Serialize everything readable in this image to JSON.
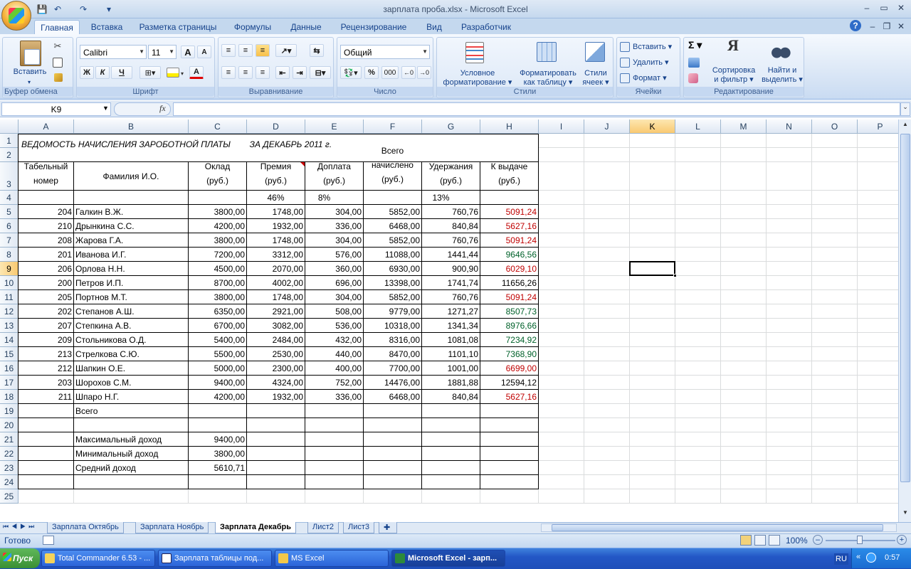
{
  "window": {
    "title": "зарплата проба.xlsx - Microsoft Excel",
    "min": "–",
    "max": "▭",
    "close": "✕",
    "ribbon_help": "?",
    "ribbon_min": "–",
    "ribbon_restore": "❐",
    "ribbon_close": "✕"
  },
  "qat": {
    "save": "💾",
    "undo": "↶",
    "redo": "↷",
    "customize": "▾"
  },
  "tabs": [
    "Главная",
    "Вставка",
    "Разметка страницы",
    "Формулы",
    "Данные",
    "Рецензирование",
    "Вид",
    "Разработчик"
  ],
  "ribbon": {
    "clipboard": {
      "label": "Буфер обмена",
      "paste": "Вставить"
    },
    "font": {
      "label": "Шрифт",
      "name": "Calibri",
      "size": "11",
      "grow": "A",
      "shrink": "A",
      "bold": "Ж",
      "italic": "К",
      "underline": "Ч",
      "color_letter": "А"
    },
    "align": {
      "label": "Выравнивание"
    },
    "number": {
      "label": "Число",
      "format": "Общий",
      "percent": "%",
      "thousands": "000"
    },
    "styles": {
      "label": "Стили",
      "cond": [
        "Условное",
        "форматирование ▾"
      ],
      "table": [
        "Форматировать",
        "как таблицу ▾"
      ],
      "cell": [
        "Стили",
        "ячеек ▾"
      ]
    },
    "cells": {
      "label": "Ячейки",
      "insert": "Вставить ▾",
      "delete": "Удалить ▾",
      "format": "Формат ▾"
    },
    "editing": {
      "label": "Редактирование",
      "sum": "Σ ▾",
      "sort": [
        "Сортировка",
        "и фильтр ▾"
      ],
      "find": [
        "Найти и",
        "выделить ▾"
      ]
    }
  },
  "formula_bar": {
    "name_box": "K9",
    "fx": "fx",
    "value": ""
  },
  "columns": [
    "A",
    "B",
    "C",
    "D",
    "E",
    "F",
    "G",
    "H",
    "I",
    "J",
    "K",
    "L",
    "M",
    "N",
    "O",
    "P"
  ],
  "rows": [
    "1",
    "2",
    "3",
    "4",
    "5",
    "6",
    "7",
    "8",
    "9",
    "10",
    "11",
    "12",
    "13",
    "14",
    "15",
    "16",
    "17",
    "18",
    "19",
    "20",
    "21",
    "22",
    "23",
    "24",
    "25"
  ],
  "sheet": {
    "title": "ВЕДОМОСТЬ НАЧИСЛЕНИЯ ЗАРОБОТНОЙ ПЛАТЫ        ЗА ДЕКАБРЬ 2011 г.",
    "headers": [
      [
        "Табельный",
        "номер"
      ],
      [
        "Фамилия И.О."
      ],
      [
        "Оклад",
        "(руб.)"
      ],
      [
        "Премия",
        "(руб.)"
      ],
      [
        "Доплата",
        "(руб.)"
      ],
      [
        "Всего",
        "начислено",
        "(руб.)"
      ],
      [
        "Удержания",
        "(руб.)"
      ],
      [
        "К выдаче",
        "(руб.)"
      ]
    ],
    "rates": {
      "bonus": "46%",
      "extra": "8%",
      "deduct": "13%"
    },
    "data": [
      {
        "id": "204",
        "name": "Галкин В.Ж.",
        "salary": "3800,00",
        "bonus": "1748,00",
        "extra": "304,00",
        "total": "5852,00",
        "deduct": "760,76",
        "pay": "5091,24",
        "pay_color": "red"
      },
      {
        "id": "210",
        "name": "Дрынкина С.С.",
        "salary": "4200,00",
        "bonus": "1932,00",
        "extra": "336,00",
        "total": "6468,00",
        "deduct": "840,84",
        "pay": "5627,16",
        "pay_color": "red"
      },
      {
        "id": "208",
        "name": "Жарова Г.А.",
        "salary": "3800,00",
        "bonus": "1748,00",
        "extra": "304,00",
        "total": "5852,00",
        "deduct": "760,76",
        "pay": "5091,24",
        "pay_color": "red"
      },
      {
        "id": "201",
        "name": "Иванова И.Г.",
        "salary": "7200,00",
        "bonus": "3312,00",
        "extra": "576,00",
        "total": "11088,00",
        "deduct": "1441,44",
        "pay": "9646,56",
        "pay_color": "green"
      },
      {
        "id": "206",
        "name": "Орлова Н.Н.",
        "salary": "4500,00",
        "bonus": "2070,00",
        "extra": "360,00",
        "total": "6930,00",
        "deduct": "900,90",
        "pay": "6029,10",
        "pay_color": "red"
      },
      {
        "id": "200",
        "name": "Петров И.П.",
        "salary": "8700,00",
        "bonus": "4002,00",
        "extra": "696,00",
        "total": "13398,00",
        "deduct": "1741,74",
        "pay": "11656,26",
        "pay_color": "black"
      },
      {
        "id": "205",
        "name": "Портнов М.Т.",
        "salary": "3800,00",
        "bonus": "1748,00",
        "extra": "304,00",
        "total": "5852,00",
        "deduct": "760,76",
        "pay": "5091,24",
        "pay_color": "red"
      },
      {
        "id": "202",
        "name": "Степанов А.Ш.",
        "salary": "6350,00",
        "bonus": "2921,00",
        "extra": "508,00",
        "total": "9779,00",
        "deduct": "1271,27",
        "pay": "8507,73",
        "pay_color": "green"
      },
      {
        "id": "207",
        "name": "Степкина А.В.",
        "salary": "6700,00",
        "bonus": "3082,00",
        "extra": "536,00",
        "total": "10318,00",
        "deduct": "1341,34",
        "pay": "8976,66",
        "pay_color": "green"
      },
      {
        "id": "209",
        "name": "Стольникова О.Д.",
        "salary": "5400,00",
        "bonus": "2484,00",
        "extra": "432,00",
        "total": "8316,00",
        "deduct": "1081,08",
        "pay": "7234,92",
        "pay_color": "green"
      },
      {
        "id": "213",
        "name": "Стрелкова С.Ю.",
        "salary": "5500,00",
        "bonus": "2530,00",
        "extra": "440,00",
        "total": "8470,00",
        "deduct": "1101,10",
        "pay": "7368,90",
        "pay_color": "green"
      },
      {
        "id": "212",
        "name": "Шапкин О.Е.",
        "salary": "5000,00",
        "bonus": "2300,00",
        "extra": "400,00",
        "total": "7700,00",
        "deduct": "1001,00",
        "pay": "6699,00",
        "pay_color": "red"
      },
      {
        "id": "203",
        "name": "Шорохов С.М.",
        "salary": "9400,00",
        "bonus": "4324,00",
        "extra": "752,00",
        "total": "14476,00",
        "deduct": "1881,88",
        "pay": "12594,12",
        "pay_color": "black"
      },
      {
        "id": "211",
        "name": "Шпаро Н.Г.",
        "salary": "4200,00",
        "bonus": "1932,00",
        "extra": "336,00",
        "total": "6468,00",
        "deduct": "840,84",
        "pay": "5627,16",
        "pay_color": "red"
      }
    ],
    "total_label": "Всего",
    "stats": [
      {
        "label": "Максимальный доход",
        "value": "9400,00"
      },
      {
        "label": "Минимальный доход",
        "value": "3800,00"
      },
      {
        "label": "Средний доход",
        "value": "5610,71"
      }
    ],
    "selected_cell": "K9"
  },
  "sheet_tabs": [
    "Зарплата Октябрь",
    "Зарплата Ноябрь",
    "Зарплата Декабрь",
    "Лист2",
    "Лист3"
  ],
  "active_sheet": "Зарплата Декабрь",
  "status": {
    "ready": "Готово",
    "zoom": "100%"
  },
  "taskbar": {
    "start": "Пуск",
    "tasks": [
      "Total Commander 6.53 - ...",
      "Зарплата таблицы под...",
      "MS Excel",
      "Microsoft Excel - зарп..."
    ],
    "lang": "RU",
    "clock": "0:57"
  },
  "colors": {
    "accent": "#15428b",
    "selection_header": "#f9c971",
    "red_text": "#c00000",
    "green_text": "#00612a"
  }
}
